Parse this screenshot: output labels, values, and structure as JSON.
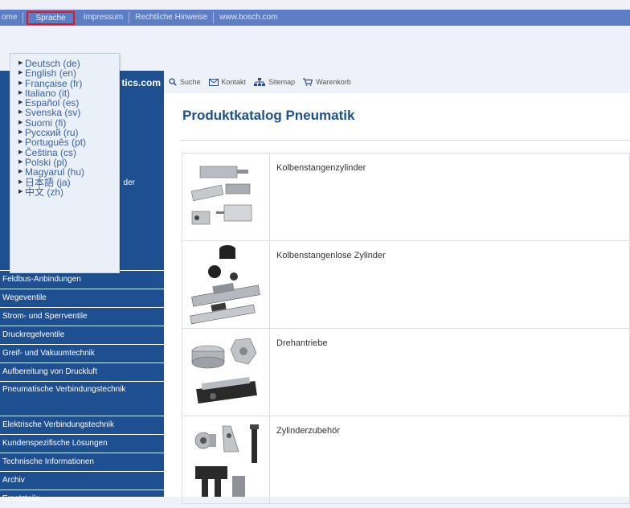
{
  "topnav": {
    "items": [
      {
        "label": "ome"
      },
      {
        "label": "Sprache"
      },
      {
        "label": "Impressum"
      },
      {
        "label": "Rechtliche Hinweise"
      },
      {
        "label": "www.bosch.com"
      }
    ],
    "active_index": 1
  },
  "brand": {
    "partial_text": "tics.com"
  },
  "toolbar": {
    "items": [
      {
        "label": "Suche",
        "icon": "search-icon"
      },
      {
        "label": "Kontakt",
        "icon": "envelope-icon"
      },
      {
        "label": "Sitemap",
        "icon": "sitemap-icon"
      },
      {
        "label": "Warenkorb",
        "icon": "cart-icon"
      }
    ]
  },
  "language_menu": {
    "items": [
      "Deutsch (de)",
      "English (en)",
      "Française (fr)",
      "Italiano (it)",
      "Español (es)",
      "Svenska (sv)",
      "Suomi (fi)",
      "Русский (ru)",
      "Português (pt)",
      "Čeština (cs)",
      "Polski (pl)",
      "Magyarul (hu)",
      "日本語 (ja)",
      "中文 (zh)"
    ]
  },
  "leftnav": {
    "partially_hidden_item": "der",
    "items": [
      "Feldbus-Anbindungen",
      "Wegeventile",
      "Strom- und Sperrventile",
      "Druckregelventile",
      "Greif- und Vakuumtechnik",
      "Aufbereitung von Druckluft",
      "Pneumatische Verbindungstechnik",
      "Elektrische Verbindungstechnik",
      "Kundenspezifische Lösungen",
      "Technische Informationen",
      "Archiv",
      "Ersatzteile"
    ]
  },
  "main": {
    "title": "Produktkatalog Pneumatik",
    "catalog": [
      {
        "label": "Kolbenstangenzylinder"
      },
      {
        "label": "Kolbenstangenlose Zylinder"
      },
      {
        "label": "Drehantriebe"
      },
      {
        "label": "Zylinderzubehör"
      }
    ]
  },
  "colors": {
    "nav_bar": "#5d7ec4",
    "active_outline": "#e0181f",
    "sidebar": "#1d4f91",
    "title": "#1d4f91"
  }
}
